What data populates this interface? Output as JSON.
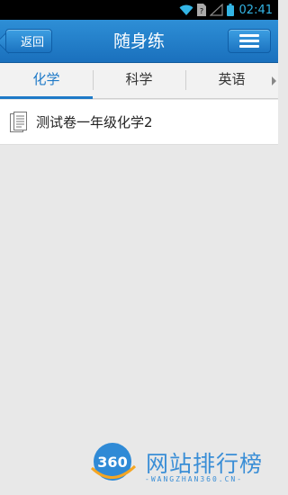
{
  "status_bar": {
    "time": "02:41",
    "icons": [
      "wifi-icon",
      "sim-card-icon",
      "signal-icon",
      "battery-icon"
    ]
  },
  "header": {
    "back_label": "返回",
    "title": "随身练",
    "menu_icon": "menu-icon"
  },
  "tabs": [
    {
      "label": "化学",
      "active": true
    },
    {
      "label": "科学",
      "active": false
    },
    {
      "label": "英语",
      "active": false
    }
  ],
  "list": [
    {
      "label": "测试卷一年级化学2",
      "icon": "document-icon"
    }
  ],
  "watermark": {
    "logo_number": "360",
    "text": "网站排行榜",
    "sub": "-WANGZHAN360.CN-"
  },
  "colors": {
    "accent": "#1f7ac8",
    "header_bg": "#2482cc",
    "status_icon": "#33b5e5",
    "page_bg": "#e8e8e8"
  }
}
